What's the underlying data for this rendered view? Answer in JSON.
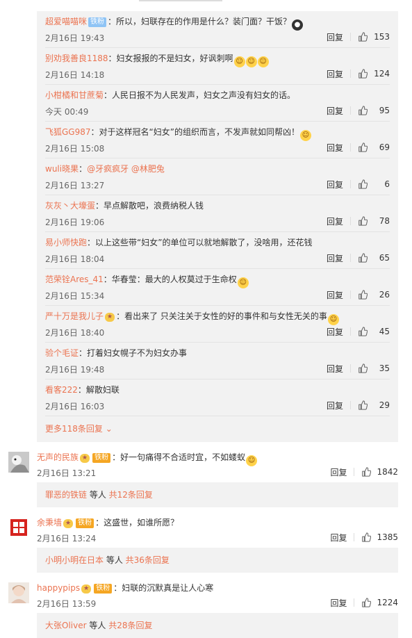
{
  "replies": [
    {
      "user": "超爱喵喵咪",
      "badge": "铁粉",
      "text": "：所以，妇联存在的作用是什么？装门面？干饭？",
      "emoji": "dark",
      "time": "2月16日 19:43",
      "likes": "153"
    },
    {
      "user": "别劝我善良1188",
      "badge": "",
      "text": "：妇女报报的不是妇女，好讽刺啊",
      "emoji": "yellow3",
      "time": "2月16日 14:18",
      "likes": "124"
    },
    {
      "user": "小柑橘和甘蔗菊",
      "badge": "",
      "text": "：人民日报不为人民发声，妇女之声没有妇女的话。",
      "emoji": "",
      "time": "今天 00:49",
      "likes": "95"
    },
    {
      "user": "飞狐GG987",
      "badge": "",
      "text": "：对于这样冠名“妇女”的组织而言，不发声就如同帮凶！",
      "emoji": "yellow",
      "time": "2月16日 15:08",
      "likes": "69"
    },
    {
      "user": "wuli晓果",
      "badge": "",
      "text": "：",
      "mention": "@牙疯疯牙 @林肥兔",
      "emoji": "",
      "time": "2月16日 13:27",
      "likes": "6"
    },
    {
      "user": "灰灰丶大壕蛋",
      "badge": "",
      "text": "：早点解散吧，浪费纳税人钱",
      "emoji": "",
      "time": "2月16日 19:06",
      "likes": "78"
    },
    {
      "user": "易小师快跑",
      "badge": "",
      "text": "：以上这些带“妇女”的单位可以就地解散了，没啥用，还花钱",
      "emoji": "",
      "time": "2月16日 18:04",
      "likes": "65"
    },
    {
      "user": "范荣铨Ares_41",
      "badge": "",
      "text": "：华春莹：最大的人权莫过于生命权",
      "emoji": "yellow",
      "time": "2月16日 15:34",
      "likes": "26"
    },
    {
      "user": "严十万是我儿子",
      "badge": "v",
      "text": "：看出来了 只关注关于女性的好的事件和与女性无关的事",
      "emoji": "yellow",
      "time": "2月16日 18:40",
      "likes": "45"
    },
    {
      "user": "验个毛证",
      "badge": "",
      "text": "：打着妇女幌子不为妇女办事",
      "emoji": "",
      "time": "2月16日 19:48",
      "likes": "35"
    },
    {
      "user": "看客222",
      "badge": "",
      "text": "：解散妇联",
      "emoji": "",
      "time": "2月16日 16:03",
      "likes": "29"
    }
  ],
  "reply_label": "回复",
  "more_replies": "更多118条回复",
  "comments": [
    {
      "user": "无声的民族",
      "badge": "铁粉",
      "text": "：好一句痛得不合适时宜，不如蝼蚁",
      "emoji": "yellow",
      "time": "2月16日 13:21",
      "likes": "1842",
      "summary_user": "罪恶的铁链",
      "summary_mid": " 等人 ",
      "summary_total": "共12条回复"
    },
    {
      "user": "余秉墙",
      "badge": "铁粉",
      "text": "：这盛世，如谁所愿？",
      "emoji": "",
      "time": "2月16日 13:24",
      "likes": "1385",
      "summary_user": "小明小明在日本",
      "summary_mid": " 等人 ",
      "summary_total": "共36条回复"
    },
    {
      "user": "happypips",
      "badge": "铁粉",
      "text": "：妇联的沉默真是让人心寒",
      "emoji": "",
      "time": "2月16日 13:59",
      "likes": "1224",
      "summary_user": "大张Oliver",
      "summary_mid": " 等人 ",
      "summary_total": "共28条回复"
    }
  ],
  "colors": {
    "accent": "#eb7350",
    "panel": "#f2f2f2"
  }
}
